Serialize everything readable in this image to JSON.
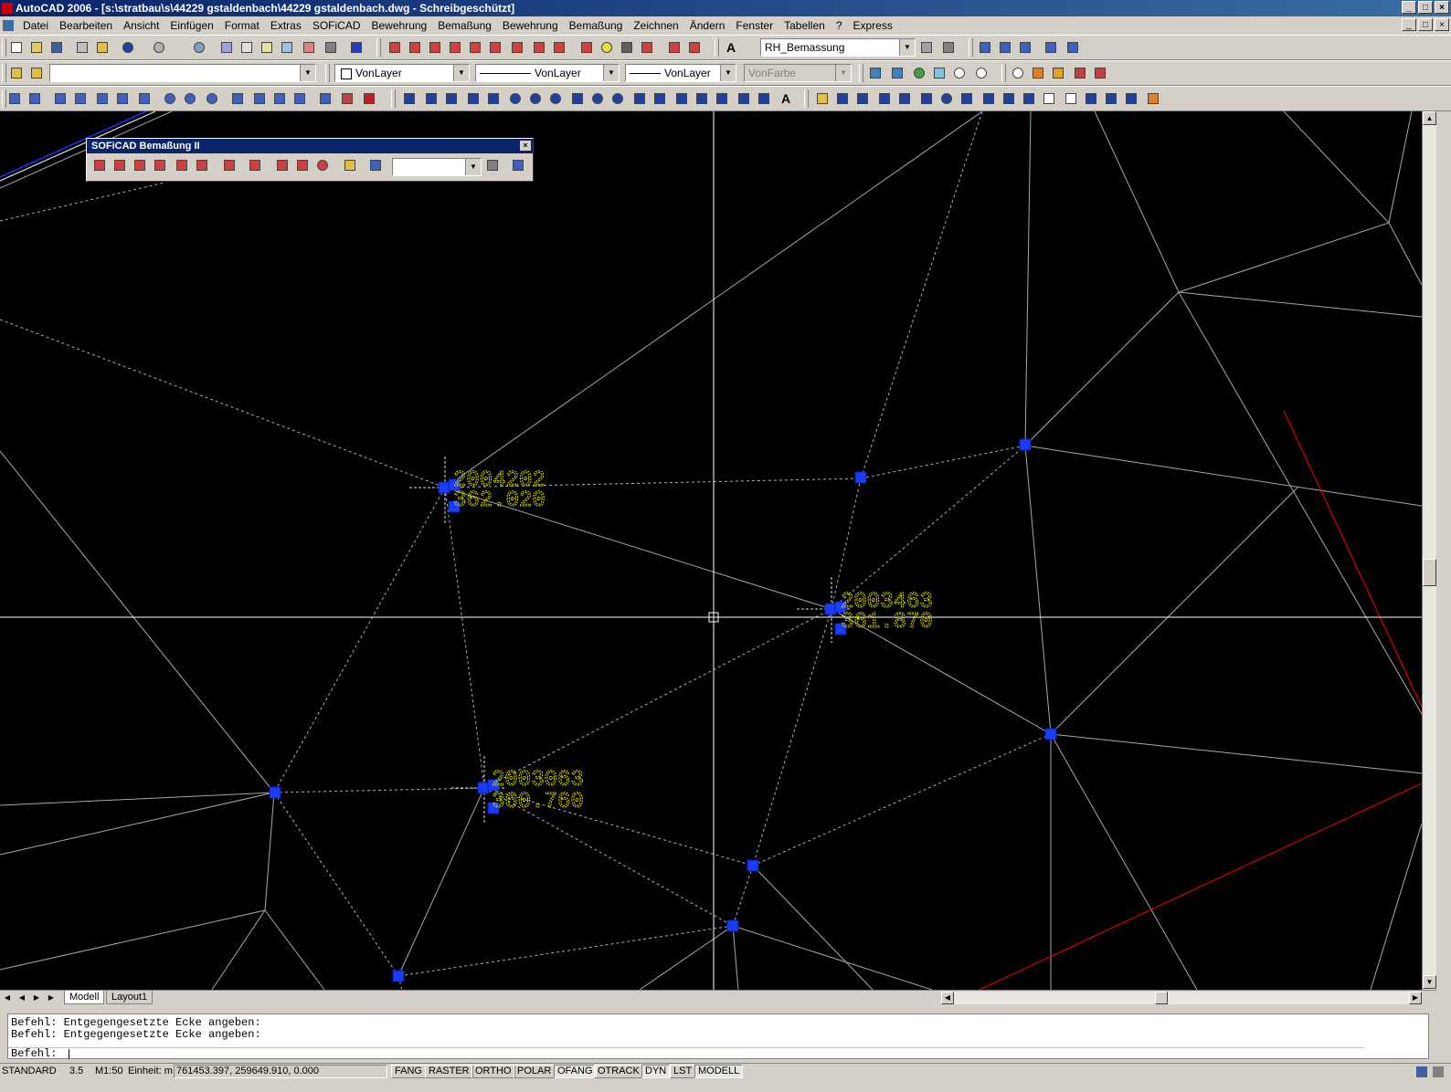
{
  "title": "AutoCAD 2006 - [s:\\stratbau\\s\\44229 gstaldenbach\\44229 gstaldenbach.dwg - Schreibgeschützt]",
  "window_buttons": [
    "_",
    "□",
    "×"
  ],
  "menu": [
    "Datei",
    "Bearbeiten",
    "Ansicht",
    "Einfügen",
    "Format",
    "Extras",
    "SOFiCAD",
    "Bewehrung",
    "Bemaßung",
    "Bewehrung",
    "Bemaßung",
    "Zeichnen",
    "Ändern",
    "Fenster",
    "Tabellen",
    "?",
    "Express"
  ],
  "toolbar": {
    "dimstyle": "RH_Bemassung",
    "layer": "",
    "color": "VonLayer",
    "linetype": "VonLayer",
    "lineweight": "VonLayer",
    "plotstyle": "VonFarbe",
    "text_icon": "A"
  },
  "soficad_toolbar": {
    "title": "SOFiCAD Bemaßung II",
    "close": "×",
    "combo": ""
  },
  "drawing": {
    "labels": [
      {
        "number": "2004202",
        "elevation": "362.020"
      },
      {
        "number": "2003463",
        "elevation": "361.870"
      },
      {
        "number": "2003063",
        "elevation": "360.760"
      }
    ],
    "colors": {
      "background": "#000000",
      "grip": "#1a3cff",
      "label": "#d8d800",
      "line": "#c8c8c8",
      "red": "#ff0000",
      "blue": "#2030ff"
    }
  },
  "tabs": [
    "Modell",
    "Layout1"
  ],
  "command": {
    "history": [
      "Befehl: Entgegengesetzte Ecke angeben:",
      "Befehl: Entgegengesetzte Ecke angeben:"
    ],
    "prompt": "Befehl:"
  },
  "status": {
    "textstyle": "STANDARD",
    "height": "3.5",
    "scale": "M1:50",
    "units": "Einheit: m",
    "coords": "761453.397, 259649.910, 0.000",
    "buttons": [
      {
        "label": "FANG",
        "on": false
      },
      {
        "label": "RASTER",
        "on": false
      },
      {
        "label": "ORTHO",
        "on": false
      },
      {
        "label": "POLAR",
        "on": false
      },
      {
        "label": "OFANG",
        "on": true
      },
      {
        "label": "OTRACK",
        "on": false
      },
      {
        "label": "DYN",
        "on": true
      },
      {
        "label": "LST",
        "on": false
      },
      {
        "label": "MODELL",
        "on": true
      }
    ]
  }
}
